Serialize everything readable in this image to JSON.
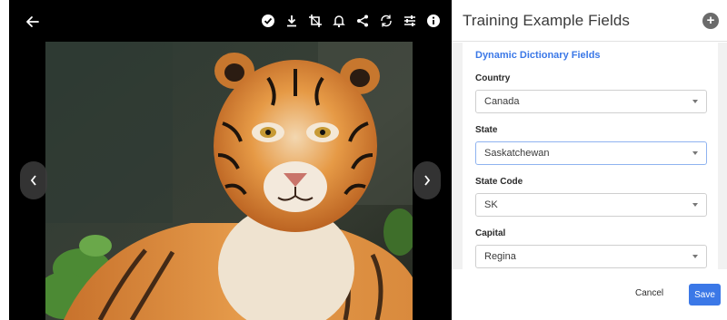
{
  "viewer": {
    "back_icon": "arrow-left-icon",
    "tools": [
      {
        "name": "check-circle-icon"
      },
      {
        "name": "download-icon"
      },
      {
        "name": "crop-icon"
      },
      {
        "name": "bell-icon"
      },
      {
        "name": "share-icon"
      },
      {
        "name": "rotate-icon"
      },
      {
        "name": "sliders-icon"
      },
      {
        "name": "info-icon"
      }
    ],
    "prev_icon": "chevron-left-icon",
    "next_icon": "chevron-right-icon"
  },
  "panel": {
    "title": "Training Example Fields",
    "add_icon": "add-circle-icon",
    "section_link": "Dynamic Dictionary Fields",
    "fields": [
      {
        "label": "Country",
        "value": "Canada"
      },
      {
        "label": "State",
        "value": "Saskatchewan"
      },
      {
        "label": "State Code",
        "value": "SK"
      },
      {
        "label": "Capital",
        "value": "Regina"
      }
    ],
    "cancel_label": "Cancel",
    "save_label": "Save"
  },
  "colors": {
    "accent": "#3b78e7",
    "viewer_bg": "#000000"
  }
}
